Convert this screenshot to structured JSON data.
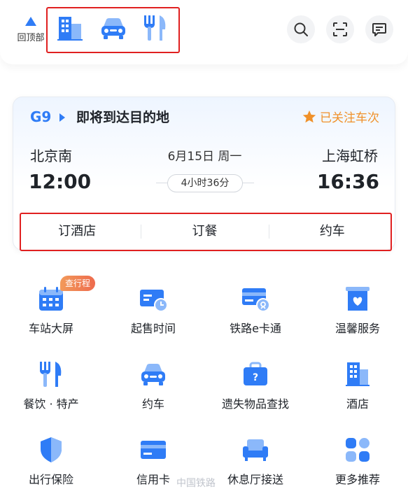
{
  "header": {
    "back_to_top": "回顶部",
    "icons": [
      "hotel-icon",
      "car-icon",
      "dining-icon"
    ],
    "actions": [
      "search-icon",
      "scan-icon",
      "message-icon"
    ]
  },
  "trip": {
    "train_no": "G9",
    "status": "即将到达目的地",
    "follow_label": "已关注车次",
    "from_station": "北京南",
    "to_station": "上海虹桥",
    "date": "6月15日 周一",
    "depart_time": "12:00",
    "arrive_time": "16:36",
    "duration": "4小时36分",
    "actions": [
      "订酒店",
      "订餐",
      "约车"
    ]
  },
  "services": [
    {
      "label": "车站大屏",
      "icon": "station-screen-icon",
      "badge": "查行程"
    },
    {
      "label": "起售时间",
      "icon": "ticket-time-icon"
    },
    {
      "label": "铁路e卡通",
      "icon": "ecard-icon"
    },
    {
      "label": "温馨服务",
      "icon": "care-service-icon"
    },
    {
      "label": "餐饮 · 特产",
      "icon": "dining-icon"
    },
    {
      "label": "约车",
      "icon": "car-icon"
    },
    {
      "label": "遗失物品查找",
      "icon": "lost-found-icon"
    },
    {
      "label": "酒店",
      "icon": "hotel-icon"
    },
    {
      "label": "出行保险",
      "icon": "insurance-icon"
    },
    {
      "label": "信用卡",
      "icon": "credit-card-icon"
    },
    {
      "label": "休息厅接送",
      "icon": "lounge-icon"
    },
    {
      "label": "更多推荐",
      "icon": "more-icon"
    }
  ],
  "watermark": "中国铁路",
  "colors": {
    "accent": "#2f7cf6",
    "highlight": "#e02020",
    "follow": "#f0912a"
  }
}
